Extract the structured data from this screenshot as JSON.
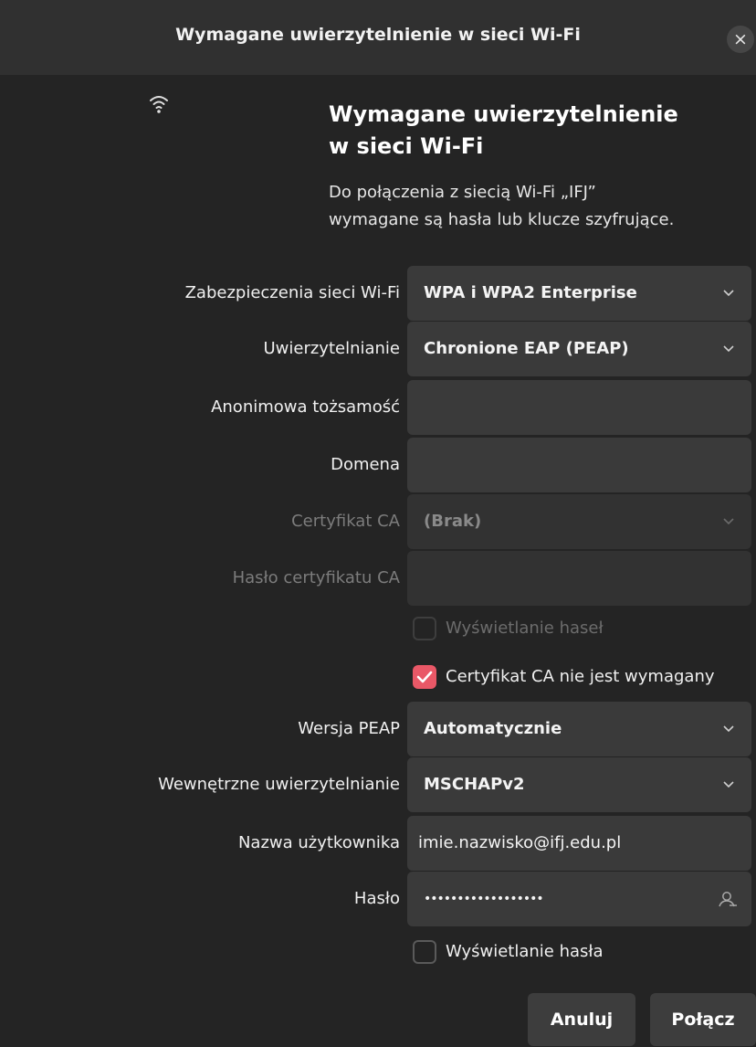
{
  "window": {
    "title": "Wymagane uwierzytelnienie w sieci Wi-Fi",
    "close_icon": "×"
  },
  "header": {
    "icon": "wifi-icon",
    "heading_line1": "Wymagane uwierzytelnienie",
    "heading_line2": "w sieci Wi-Fi",
    "desc_line1": "Do połączenia z siecią Wi-Fi „IFJ”",
    "desc_line2": "wymagane są hasła lub klucze szyfrujące."
  },
  "form": {
    "security": {
      "label": "Zabezpieczenia sieci Wi-Fi",
      "value": "WPA i WPA2 Enterprise"
    },
    "auth": {
      "label": "Uwierzytelnianie",
      "value": "Chronione EAP (PEAP)"
    },
    "anon_identity": {
      "label": "Anonimowa tożsamość",
      "value": ""
    },
    "domain": {
      "label": "Domena",
      "value": ""
    },
    "ca_cert": {
      "label": "Certyfikat CA",
      "value": "(Brak)"
    },
    "ca_cert_password": {
      "label": "Hasło certyfikatu CA",
      "value": ""
    },
    "show_passwords": {
      "label": "Wyświetlanie haseł",
      "checked": false
    },
    "no_ca_required": {
      "label": "Certyfikat CA nie jest wymagany",
      "checked": true
    },
    "peap_version": {
      "label": "Wersja PEAP",
      "value": "Automatycznie"
    },
    "inner_auth": {
      "label": "Wewnętrzne uwierzytelnianie",
      "value": "MSCHAPv2"
    },
    "username": {
      "label": "Nazwa użytkownika",
      "value": "imie.nazwisko@ifj.edu.pl"
    },
    "password": {
      "label": "Hasło",
      "value": "••••••••••••••••••"
    },
    "show_password": {
      "label": "Wyświetlanie hasła",
      "checked": false
    }
  },
  "buttons": {
    "cancel": "Anuluj",
    "connect": "Połącz"
  },
  "colors": {
    "accent": "#e95867",
    "background": "#242424",
    "field": "#3a3a3a"
  }
}
